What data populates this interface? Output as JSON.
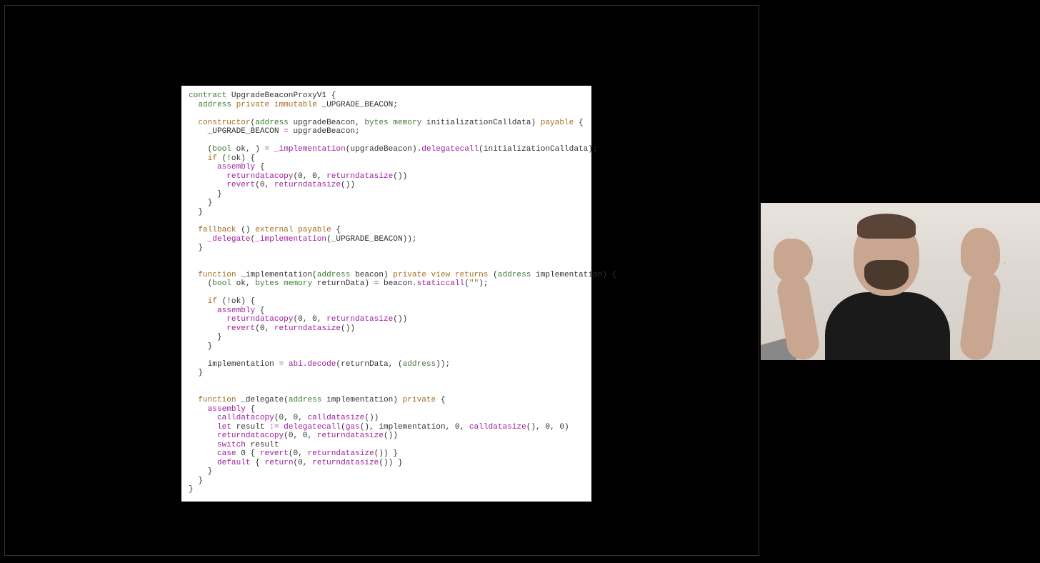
{
  "code": {
    "l1a": "contract",
    "l1b": " UpgradeBeaconProxyV1 {",
    "l2a": "  address",
    "l2b": " private immutable",
    "l2c": " _UPGRADE_BEACON;",
    "l3": "",
    "l4a": "  constructor",
    "l4b": "(",
    "l4c": "address",
    "l4d": " upgradeBeacon, ",
    "l4e": "bytes memory",
    "l4f": " initializationCalldata) ",
    "l4g": "payable",
    "l4h": " {",
    "l5a": "    _UPGRADE_BEACON ",
    "l5b": "=",
    "l5c": " upgradeBeacon;",
    "l6": "",
    "l7a": "    (",
    "l7b": "bool",
    "l7c": " ok, ) ",
    "l7d": "=",
    "l7e": " _implementation",
    "l7f": "(upgradeBeacon).",
    "l7g": "delegatecall",
    "l7h": "(initializationCalldata);",
    "l8a": "    if",
    "l8b": " (!ok) {",
    "l9a": "      assembly",
    "l9b": " {",
    "l10a": "        returndatacopy",
    "l10b": "(0, 0, ",
    "l10c": "returndatasize",
    "l10d": "())",
    "l11a": "        revert",
    "l11b": "(0, ",
    "l11c": "returndatasize",
    "l11d": "())",
    "l12": "      }",
    "l13": "    }",
    "l14": "  }",
    "l15": "",
    "l16a": "  fallback",
    "l16b": " () ",
    "l16c": "external payable",
    "l16d": " {",
    "l17a": "    _delegate",
    "l17b": "(",
    "l17c": "_implementation",
    "l17d": "(_UPGRADE_BEACON));",
    "l18": "  }",
    "l19": "",
    "l20": "",
    "l21a": "  function",
    "l21b": " _implementation(",
    "l21c": "address",
    "l21d": " beacon) ",
    "l21e": "private view returns",
    "l21f": " (",
    "l21g": "address",
    "l21h": " implementation) {",
    "l22a": "    (",
    "l22b": "bool",
    "l22c": " ok, ",
    "l22d": "bytes memory",
    "l22e": " returnData) ",
    "l22f": "=",
    "l22g": " beacon.",
    "l22h": "staticcall",
    "l22i": "(",
    "l22j": "\"\"",
    "l22k": ");",
    "l23": "",
    "l24a": "    if",
    "l24b": " (!ok) {",
    "l25a": "      assembly",
    "l25b": " {",
    "l26a": "        returndatacopy",
    "l26b": "(0, 0, ",
    "l26c": "returndatasize",
    "l26d": "())",
    "l27a": "        revert",
    "l27b": "(0, ",
    "l27c": "returndatasize",
    "l27d": "())",
    "l28": "      }",
    "l29": "    }",
    "l30": "",
    "l31a": "    implementation ",
    "l31b": "=",
    "l31c": " abi.decode",
    "l31d": "(returnData, (",
    "l31e": "address",
    "l31f": "));",
    "l32": "  }",
    "l33": "",
    "l34": "",
    "l35a": "  function",
    "l35b": " _delegate(",
    "l35c": "address",
    "l35d": " implementation) ",
    "l35e": "private",
    "l35f": " {",
    "l36a": "    assembly",
    "l36b": " {",
    "l37a": "      calldatacopy",
    "l37b": "(0, 0, ",
    "l37c": "calldatasize",
    "l37d": "())",
    "l38a": "      let",
    "l38b": " result ",
    "l38c": ":=",
    "l38d": " delegatecall",
    "l38e": "(",
    "l38f": "gas",
    "l38g": "(), implementation, 0, ",
    "l38h": "calldatasize",
    "l38i": "(), 0, 0)",
    "l39a": "      returndatacopy",
    "l39b": "(0, 0, ",
    "l39c": "returndatasize",
    "l39d": "())",
    "l40a": "      switch",
    "l40b": " result",
    "l41a": "      case",
    "l41b": " 0 { ",
    "l41c": "revert",
    "l41d": "(0, ",
    "l41e": "returndatasize",
    "l41f": "()) }",
    "l42a": "      default",
    "l42b": " { ",
    "l42c": "return",
    "l42d": "(0, ",
    "l42e": "returndatasize",
    "l42f": "()) }",
    "l43": "    }",
    "l44": "  }",
    "l45": "}"
  },
  "webcam": {
    "label": "presenter-webcam"
  }
}
